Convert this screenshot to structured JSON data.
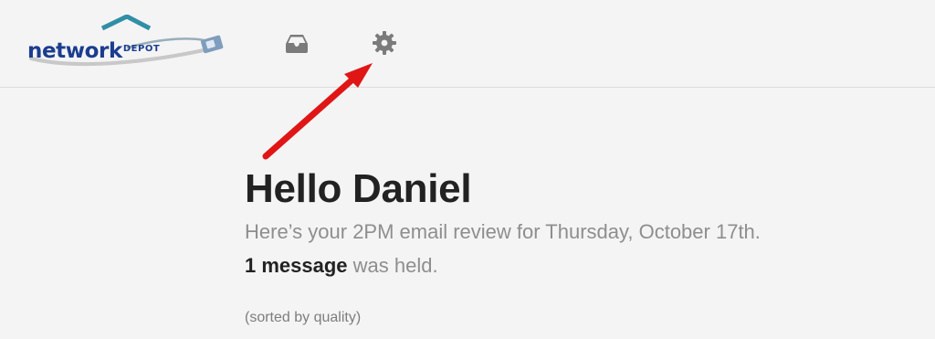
{
  "header": {
    "logo": {
      "main": "network",
      "sub": "DEPOT",
      "icon": "network-depot-logo"
    },
    "nav": [
      {
        "icon": "inbox-icon"
      },
      {
        "icon": "gear-icon"
      }
    ],
    "annotation": "red-arrow-pointing-to-gear"
  },
  "main": {
    "greeting": "Hello Daniel",
    "review": "Here’s your 2PM email review for Thursday, October 17th.",
    "held_count": "1 message",
    "held_suffix": " was held.",
    "sort_note": "(sorted by quality)"
  },
  "colors": {
    "background": "#f4f4f4",
    "logo_blue": "#1b3d8f",
    "logo_teal": "#2f8fa6",
    "icon_gray": "#7b7b7b",
    "arrow_red": "#e01616",
    "heading": "#222222",
    "muted_text": "#8e8e8e"
  }
}
